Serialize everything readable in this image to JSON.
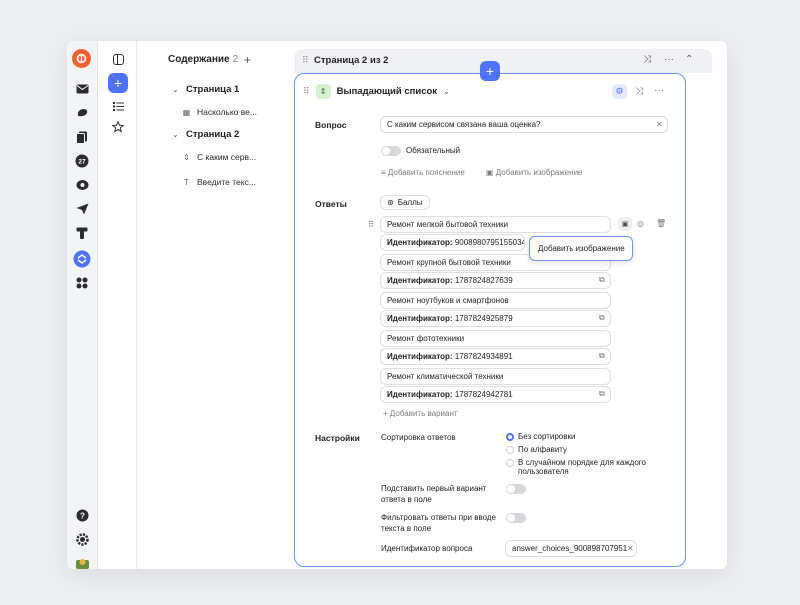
{
  "rail": {
    "logo": "",
    "icons": [
      "mail-icon",
      "disk-icon",
      "docs-icon",
      "calendar-icon",
      "messenger-icon",
      "telemost-icon",
      "tracker-icon",
      "forms-icon",
      "apps-icon"
    ],
    "calendar_day": "27",
    "bottom_icons": [
      "help-icon",
      "settings-icon",
      "avatar"
    ]
  },
  "sidebar": {
    "icons": [
      "panel-icon",
      "add-icon",
      "list-icon",
      "star-icon"
    ],
    "add_label": "+"
  },
  "contents": {
    "title": "Содержание",
    "count": "2",
    "add": "+",
    "pages": [
      {
        "label": "Страница 1",
        "items": [
          {
            "icon": "▦",
            "label": "Насколько ве..."
          }
        ]
      },
      {
        "label": "Страница 2",
        "items": [
          {
            "icon": "⇕",
            "label": "С каким серв..."
          },
          {
            "icon": "T",
            "label": "Введите текс..."
          }
        ]
      }
    ]
  },
  "page": {
    "title": "Страница 2 из 2"
  },
  "question": {
    "add": "+",
    "type_label": "Выпадающий список",
    "question_label": "Вопрос",
    "question_value": "С каким сервисом связана ваша оценка?",
    "required_label": "Обязательный",
    "add_hint": "Добавить пояснение",
    "add_image": "Добавить изображение",
    "answers_label": "Ответы",
    "points_label": "Баллы",
    "tooltip": "Добавить изображение",
    "id_key": "Идентификатор:",
    "answers": [
      {
        "text": "Ремонт мелкой бытовой техники",
        "id": "9008980795155034"
      },
      {
        "text": "Ремонт крупной бытовой техники",
        "id": "1787824827639"
      },
      {
        "text": "Ремонт ноутбуков и смартфонов",
        "id": "1787824925879"
      },
      {
        "text": "Ремонт фототехники",
        "id": "1787824934891"
      },
      {
        "text": "Ремонт климатической техники",
        "id": "1787824942781"
      }
    ],
    "add_variant": "Добавить вариант",
    "settings_label": "Настройки",
    "sort_label": "Сортировка ответов",
    "sort_options": [
      "Без сортировки",
      "По алфавиту",
      "В случайном порядке для каждого пользователя"
    ],
    "sort_selected": "Без сортировки",
    "opt_first_label": "Подставить первый вариант ответа в поле",
    "opt_filter_label": "Фильтровать ответы при вводе текста в поле",
    "qid_label": "Идентификатор вопроса",
    "qid_value": "answer_choices_900898707951"
  },
  "colors": {
    "accent": "#4f73f5",
    "logo": "#f0632d",
    "type_badge": "#d6f0d0"
  }
}
